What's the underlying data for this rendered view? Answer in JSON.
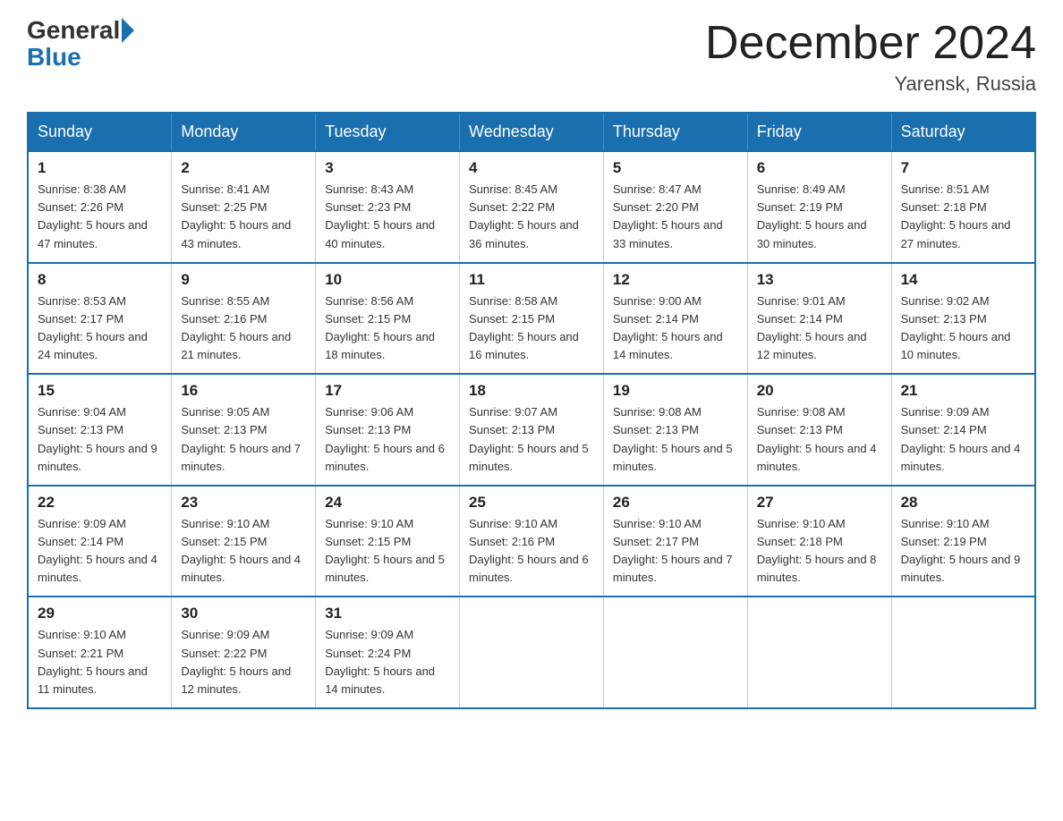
{
  "header": {
    "logo_general": "General",
    "logo_blue": "Blue",
    "month_title": "December 2024",
    "location": "Yarensk, Russia"
  },
  "weekdays": [
    "Sunday",
    "Monday",
    "Tuesday",
    "Wednesday",
    "Thursday",
    "Friday",
    "Saturday"
  ],
  "weeks": [
    [
      {
        "day": "1",
        "sunrise": "8:38 AM",
        "sunset": "2:26 PM",
        "daylight": "5 hours and 47 minutes."
      },
      {
        "day": "2",
        "sunrise": "8:41 AM",
        "sunset": "2:25 PM",
        "daylight": "5 hours and 43 minutes."
      },
      {
        "day": "3",
        "sunrise": "8:43 AM",
        "sunset": "2:23 PM",
        "daylight": "5 hours and 40 minutes."
      },
      {
        "day": "4",
        "sunrise": "8:45 AM",
        "sunset": "2:22 PM",
        "daylight": "5 hours and 36 minutes."
      },
      {
        "day": "5",
        "sunrise": "8:47 AM",
        "sunset": "2:20 PM",
        "daylight": "5 hours and 33 minutes."
      },
      {
        "day": "6",
        "sunrise": "8:49 AM",
        "sunset": "2:19 PM",
        "daylight": "5 hours and 30 minutes."
      },
      {
        "day": "7",
        "sunrise": "8:51 AM",
        "sunset": "2:18 PM",
        "daylight": "5 hours and 27 minutes."
      }
    ],
    [
      {
        "day": "8",
        "sunrise": "8:53 AM",
        "sunset": "2:17 PM",
        "daylight": "5 hours and 24 minutes."
      },
      {
        "day": "9",
        "sunrise": "8:55 AM",
        "sunset": "2:16 PM",
        "daylight": "5 hours and 21 minutes."
      },
      {
        "day": "10",
        "sunrise": "8:56 AM",
        "sunset": "2:15 PM",
        "daylight": "5 hours and 18 minutes."
      },
      {
        "day": "11",
        "sunrise": "8:58 AM",
        "sunset": "2:15 PM",
        "daylight": "5 hours and 16 minutes."
      },
      {
        "day": "12",
        "sunrise": "9:00 AM",
        "sunset": "2:14 PM",
        "daylight": "5 hours and 14 minutes."
      },
      {
        "day": "13",
        "sunrise": "9:01 AM",
        "sunset": "2:14 PM",
        "daylight": "5 hours and 12 minutes."
      },
      {
        "day": "14",
        "sunrise": "9:02 AM",
        "sunset": "2:13 PM",
        "daylight": "5 hours and 10 minutes."
      }
    ],
    [
      {
        "day": "15",
        "sunrise": "9:04 AM",
        "sunset": "2:13 PM",
        "daylight": "5 hours and 9 minutes."
      },
      {
        "day": "16",
        "sunrise": "9:05 AM",
        "sunset": "2:13 PM",
        "daylight": "5 hours and 7 minutes."
      },
      {
        "day": "17",
        "sunrise": "9:06 AM",
        "sunset": "2:13 PM",
        "daylight": "5 hours and 6 minutes."
      },
      {
        "day": "18",
        "sunrise": "9:07 AM",
        "sunset": "2:13 PM",
        "daylight": "5 hours and 5 minutes."
      },
      {
        "day": "19",
        "sunrise": "9:08 AM",
        "sunset": "2:13 PM",
        "daylight": "5 hours and 5 minutes."
      },
      {
        "day": "20",
        "sunrise": "9:08 AM",
        "sunset": "2:13 PM",
        "daylight": "5 hours and 4 minutes."
      },
      {
        "day": "21",
        "sunrise": "9:09 AM",
        "sunset": "2:14 PM",
        "daylight": "5 hours and 4 minutes."
      }
    ],
    [
      {
        "day": "22",
        "sunrise": "9:09 AM",
        "sunset": "2:14 PM",
        "daylight": "5 hours and 4 minutes."
      },
      {
        "day": "23",
        "sunrise": "9:10 AM",
        "sunset": "2:15 PM",
        "daylight": "5 hours and 4 minutes."
      },
      {
        "day": "24",
        "sunrise": "9:10 AM",
        "sunset": "2:15 PM",
        "daylight": "5 hours and 5 minutes."
      },
      {
        "day": "25",
        "sunrise": "9:10 AM",
        "sunset": "2:16 PM",
        "daylight": "5 hours and 6 minutes."
      },
      {
        "day": "26",
        "sunrise": "9:10 AM",
        "sunset": "2:17 PM",
        "daylight": "5 hours and 7 minutes."
      },
      {
        "day": "27",
        "sunrise": "9:10 AM",
        "sunset": "2:18 PM",
        "daylight": "5 hours and 8 minutes."
      },
      {
        "day": "28",
        "sunrise": "9:10 AM",
        "sunset": "2:19 PM",
        "daylight": "5 hours and 9 minutes."
      }
    ],
    [
      {
        "day": "29",
        "sunrise": "9:10 AM",
        "sunset": "2:21 PM",
        "daylight": "5 hours and 11 minutes."
      },
      {
        "day": "30",
        "sunrise": "9:09 AM",
        "sunset": "2:22 PM",
        "daylight": "5 hours and 12 minutes."
      },
      {
        "day": "31",
        "sunrise": "9:09 AM",
        "sunset": "2:24 PM",
        "daylight": "5 hours and 14 minutes."
      },
      null,
      null,
      null,
      null
    ]
  ]
}
